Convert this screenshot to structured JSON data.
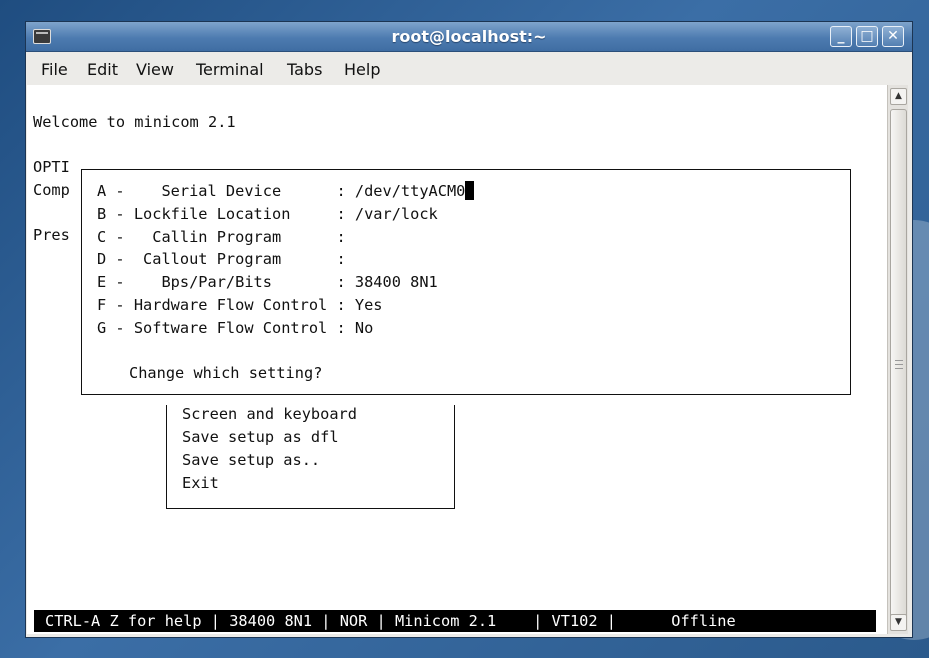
{
  "window": {
    "title": "root@localhost:~",
    "buttons": {
      "minimize": "_",
      "maximize": "□",
      "close": "✕"
    }
  },
  "menu": {
    "items": [
      "File",
      "Edit",
      "View",
      "Terminal",
      "Tabs",
      "Help"
    ]
  },
  "terminal": {
    "welcome": "Welcome to minicom 2.1",
    "bg_fragments": [
      "OPTI",
      "Comp",
      "Pres"
    ],
    "dialog": {
      "settings": [
        "A -    Serial Device      : /dev/ttyACM0",
        "B - Lockfile Location     : /var/lock",
        "C -   Callin Program      :",
        "D -  Callout Program      :",
        "E -    Bps/Par/Bits       : 38400 8N1",
        "F - Hardware Flow Control : Yes",
        "G - Software Flow Control : No"
      ],
      "prompt": "Change which setting?"
    },
    "config_menu": [
      "Screen and keyboard",
      "Save setup as dfl",
      "Save setup as..",
      "Exit"
    ],
    "status_line": "CTRL-A Z for help | 38400 8N1 | NOR | Minicom 2.1    | VT102 |      Offline"
  },
  "icons": {
    "app": "terminal-icon",
    "scroll_up": "arrow-up-icon",
    "scroll_down": "arrow-down-icon"
  },
  "colors": {
    "titlebar": "#4d7bb0",
    "terminal_bg": "#ffffff",
    "status_bg": "#000000",
    "desktop": "#2f5f93"
  }
}
